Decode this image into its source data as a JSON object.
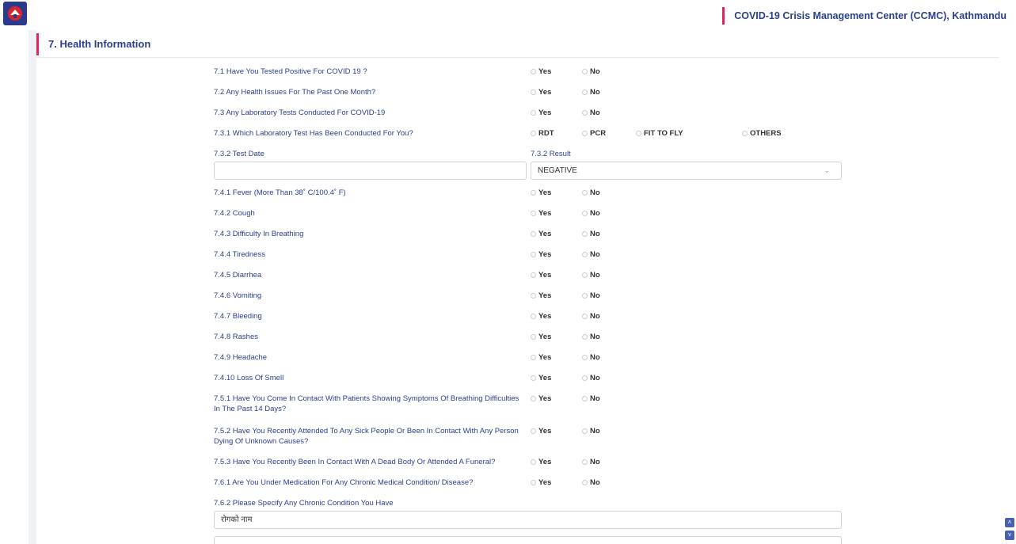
{
  "header": {
    "title": "COVID-19 Crisis Management Center (CCMC), Kathmandu",
    "logo_icon": "nepal-emblem-icon"
  },
  "section": {
    "title": "7. Health Information"
  },
  "options": {
    "yes": "Yes",
    "no": "No"
  },
  "questions": [
    {
      "label": "7.1 Have You Tested Positive For COVID 19 ?"
    },
    {
      "label": "7.2 Any Health Issues For The Past One Month?"
    },
    {
      "label": "7.3 Any Laboratory Tests Conducted For COVID-19"
    },
    {
      "label": "7.3.1 Which Laboratory Test Has Been Conducted For You?"
    },
    {
      "label": "7.4.1 Fever (More Than 38˚ C/100.4˚ F)"
    },
    {
      "label": "7.4.2 Cough"
    },
    {
      "label": "7.4.3 Difficulty In Breathing"
    },
    {
      "label": "7.4.4 Tiredness"
    },
    {
      "label": "7.4.5 Diarrhea"
    },
    {
      "label": "7.4.6 Vomiting"
    },
    {
      "label": "7.4.7 Bleeding"
    },
    {
      "label": "7.4.8 Rashes"
    },
    {
      "label": "7.4.9 Headache"
    },
    {
      "label": "7.4.10 Loss Of Smell"
    },
    {
      "label": "7.5.1 Have You Come In Contact With Patients Showing Symptoms Of Breathing Difficulties In The Past 14 Days?"
    },
    {
      "label": "7.5.2 Have You Recently Attended To Any Sick People Or Been In Contact With Any Person Dying Of Unknown Causes?"
    },
    {
      "label": "7.5.3 Have You Recently Been In Contact With A Dead Body Or Attended A Funeral?"
    },
    {
      "label": "7.6.1 Are You Under Medication For Any Chronic Medical Condition/ Disease?"
    }
  ],
  "lab_tests": {
    "rdt": "RDT",
    "pcr": "PCR",
    "fit": "FIT TO FLY",
    "others": "OTHERS"
  },
  "test_date": {
    "label": "7.3.2 Test Date",
    "value": ""
  },
  "test_result": {
    "label": "7.3.2 Result",
    "value": "NEGATIVE"
  },
  "chronic": {
    "label": "7.6.2 Please Specify Any Chronic Condition You Have",
    "placeholder": "रोगको नाम"
  }
}
